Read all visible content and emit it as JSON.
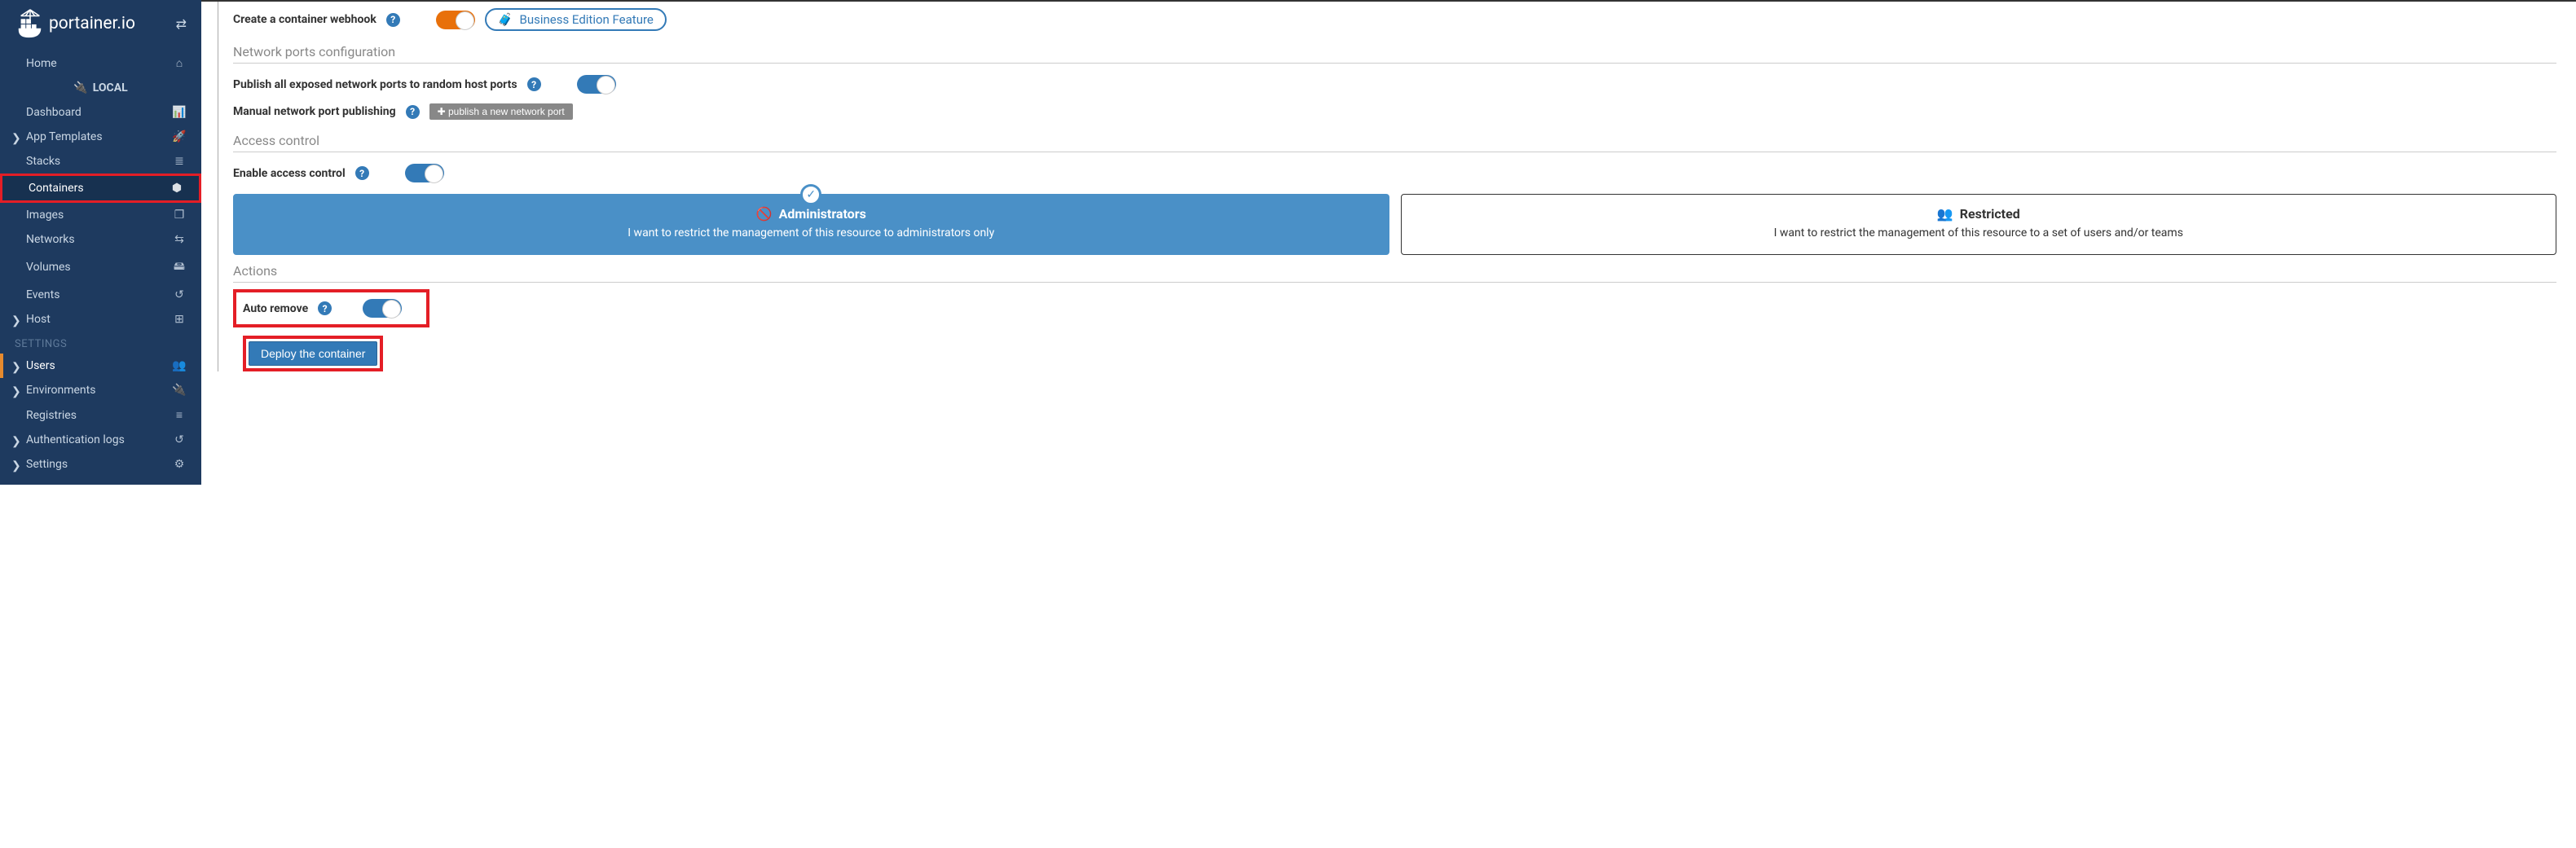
{
  "brand": "portainer.io",
  "sidebar": {
    "env_label": "LOCAL",
    "items": [
      {
        "label": "Home",
        "icon": "⌂"
      },
      {
        "label": "Dashboard",
        "icon": "📊"
      },
      {
        "label": "App Templates",
        "icon": "🚀",
        "chev": true
      },
      {
        "label": "Stacks",
        "icon": "≣"
      },
      {
        "label": "Containers",
        "icon": "⬢",
        "active": true
      },
      {
        "label": "Images",
        "icon": "❐"
      },
      {
        "label": "Networks",
        "icon": "⇆"
      },
      {
        "label": "Volumes",
        "icon": "🖴"
      },
      {
        "label": "Events",
        "icon": "↺"
      },
      {
        "label": "Host",
        "icon": "⊞",
        "chev": true
      }
    ],
    "settings_heading": "SETTINGS",
    "settings": [
      {
        "label": "Users",
        "icon": "👥",
        "active_border": true,
        "chev": true
      },
      {
        "label": "Environments",
        "icon": "🔌",
        "chev": true
      },
      {
        "label": "Registries",
        "icon": "≡"
      },
      {
        "label": "Authentication logs",
        "icon": "↺",
        "chev": true
      },
      {
        "label": "Settings",
        "icon": "⚙",
        "chev": true
      }
    ]
  },
  "main": {
    "webhook_label": "Create a container webhook",
    "be_feature": "Business Edition Feature",
    "section_network": "Network ports configuration",
    "publish_all_label": "Publish all exposed network ports to random host ports",
    "manual_port_label": "Manual network port publishing",
    "publish_port_btn": "publish a new network port",
    "section_access": "Access control",
    "enable_access_label": "Enable access control",
    "card_admin_title": "Administrators",
    "card_admin_desc": "I want to restrict the management of this resource to administrators only",
    "card_restricted_title": "Restricted",
    "card_restricted_desc": "I want to restrict the management of this resource to a set of users and/or teams",
    "section_actions": "Actions",
    "auto_remove_label": "Auto remove",
    "deploy_btn": "Deploy the container"
  }
}
